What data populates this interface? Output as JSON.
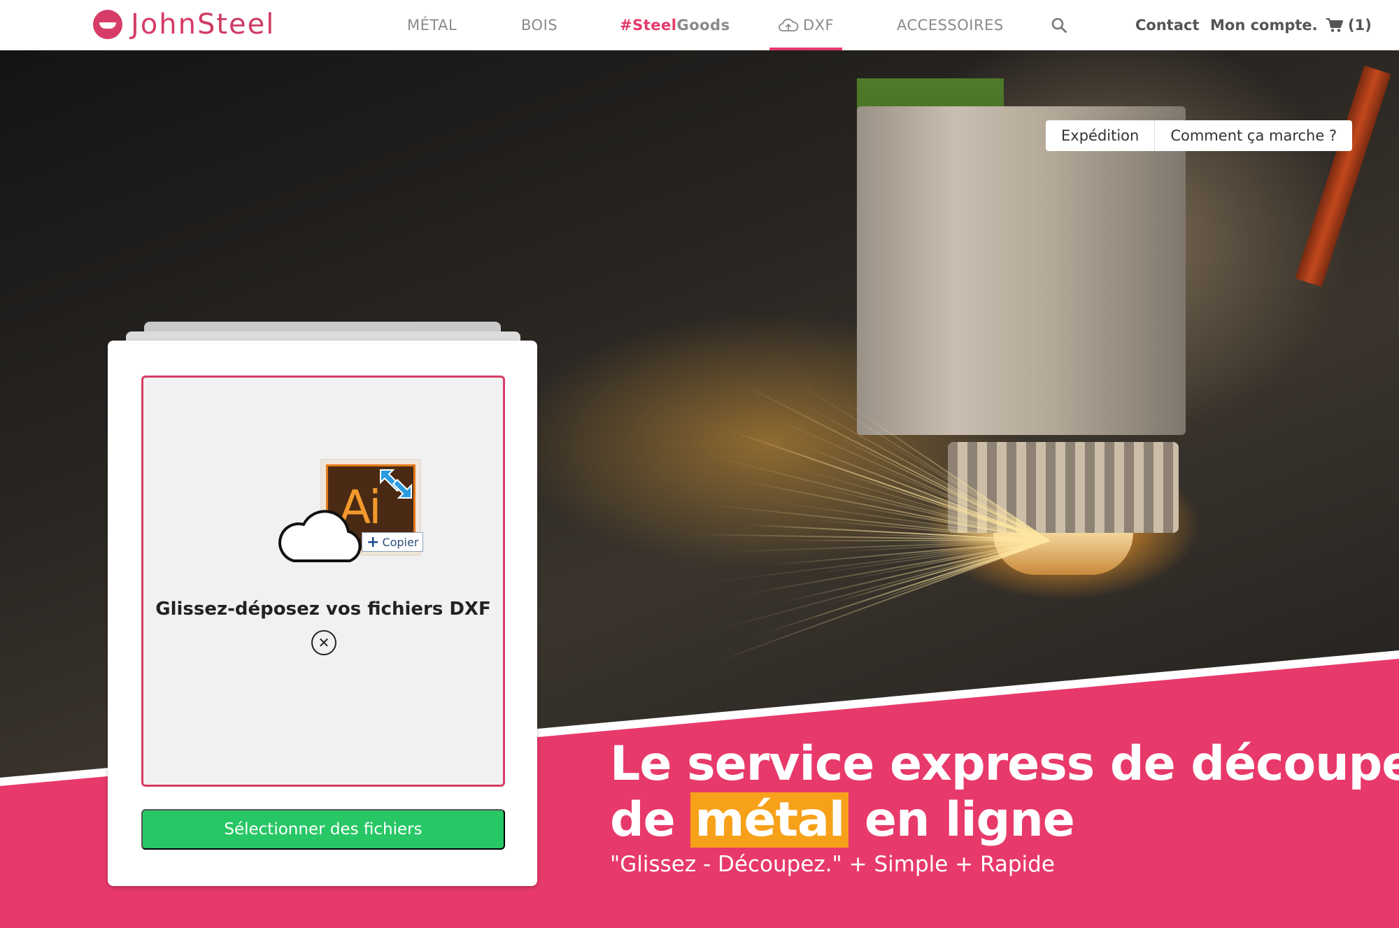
{
  "brand": {
    "name_part1": "John",
    "name_part2": "Steel",
    "color": "#d63c67"
  },
  "nav": {
    "metal": "MÉTAL",
    "bois": "BOIS",
    "steelgoods_hash": "#Steel",
    "steelgoods_rest": "Goods",
    "dxf": "DXF",
    "accessoires": "ACCESSOIRES",
    "contact": "Contact",
    "account": "Mon compte.",
    "cart": "(1)",
    "active": "DXF"
  },
  "info_tabs": {
    "expedition": "Expédition",
    "how": "Comment ça marche ?"
  },
  "upload": {
    "copy_badge": "Copier",
    "ai_label": "Ai",
    "dropzone_title": "Glissez-déposez vos fichiers DXF",
    "cancel_symbol": "✕",
    "select_button": "Sélectionner des fichiers"
  },
  "hero": {
    "line1": "Le service express de découpe",
    "line2_start": "de",
    "line2_highlight": "métal",
    "line2_end": "en ligne",
    "tagline": "\"Glissez - Découpez.\" + Simple + Rapide"
  },
  "colors": {
    "accent_pink": "#e33a6a",
    "band_pink": "#e8396b",
    "green_button": "#27c765",
    "highlight_orange": "#f7a11a"
  },
  "icons": [
    "cloud-upload-icon",
    "search-icon",
    "cart-icon",
    "cloud-outline-icon",
    "illustrator-file-icon",
    "close-circle-icon"
  ]
}
